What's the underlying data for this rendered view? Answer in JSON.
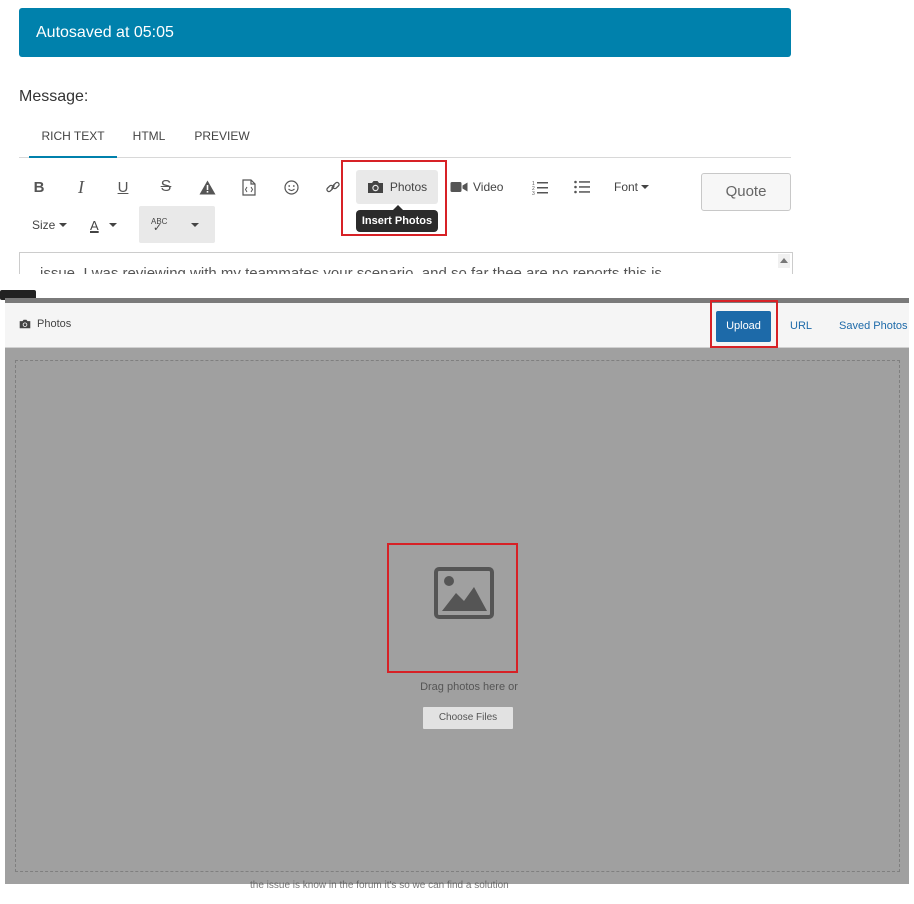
{
  "banner": {
    "text": "Autosaved at 05:05"
  },
  "editor": {
    "label": "Message:",
    "tabs": [
      {
        "label": "RICH TEXT",
        "active": true
      },
      {
        "label": "HTML",
        "active": false
      },
      {
        "label": "PREVIEW",
        "active": false
      }
    ],
    "toolbar": {
      "bold": "B",
      "italic": "I",
      "underline": "U",
      "strike": "S",
      "photos": "Photos",
      "photos_tooltip": "Insert Photos",
      "video": "Video",
      "font": "Font",
      "size": "Size",
      "text_color": "A",
      "spell_icon": "ABC",
      "quote": "Quote"
    },
    "text_line": "issue. I was reviewing with my teammates your scenario, and so far thee are no reports this is"
  },
  "photos_dialog": {
    "title": "Photos",
    "upload": "Upload",
    "url": "URL",
    "saved_photos": "Saved Photos",
    "drop_text": "Drag photos here or",
    "choose_files": "Choose Files"
  },
  "behind_text": "the issue is know in the forum it's so we can find a solution",
  "colors": {
    "banner": "#0081ac",
    "active_tab": "#0081ac",
    "upload_button": "#1d6aa9",
    "highlight": "#d72126",
    "dialog_backdrop": "#a0a0a0"
  },
  "icons": [
    "camera-icon",
    "video-camera-icon",
    "warning-icon",
    "code-file-icon",
    "emoji-icon",
    "link-icon",
    "ordered-list-icon",
    "unordered-list-icon",
    "spellcheck-icon",
    "image-placeholder-icon"
  ]
}
